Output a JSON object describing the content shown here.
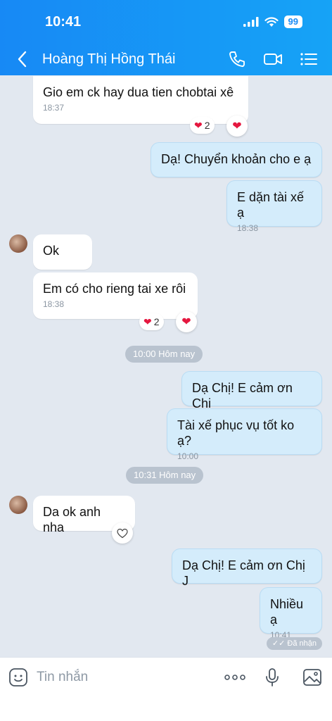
{
  "status": {
    "time": "10:41",
    "battery": "99"
  },
  "header": {
    "title": "Hoàng Thị Hồng Thái"
  },
  "messages": [
    {
      "text": "Gio em ck hay dua tien chobtai xê",
      "time": "18:37",
      "reaction_count": "2"
    },
    {
      "text": "Dạ! Chuyển khoản cho e ạ"
    },
    {
      "text": "E dặn tài xế ạ",
      "time": "18:38"
    },
    {
      "text": "Ok"
    },
    {
      "text": "Em có cho rieng tai xe rôi",
      "time": "18:38",
      "reaction_count": "2"
    },
    {
      "text": "Dạ Chị! E cảm ơn Chị"
    },
    {
      "text": "Tài xế phục vụ tốt ko ạ?",
      "time": "10:00"
    },
    {
      "text": "Da ok anh nha"
    },
    {
      "text": "Dạ Chị! E cảm ơn Chị J"
    },
    {
      "text": "Nhiều ạ",
      "time": "10:41"
    }
  ],
  "separators": [
    "10:00 Hôm nay",
    "10:31 Hôm nay"
  ],
  "seen_label": "Đã nhận",
  "input": {
    "placeholder": "Tin nhắn"
  },
  "colors": {
    "header": "#1789f5",
    "outgoing_bubble": "#d4ecfb",
    "background": "#e2e8f0"
  }
}
